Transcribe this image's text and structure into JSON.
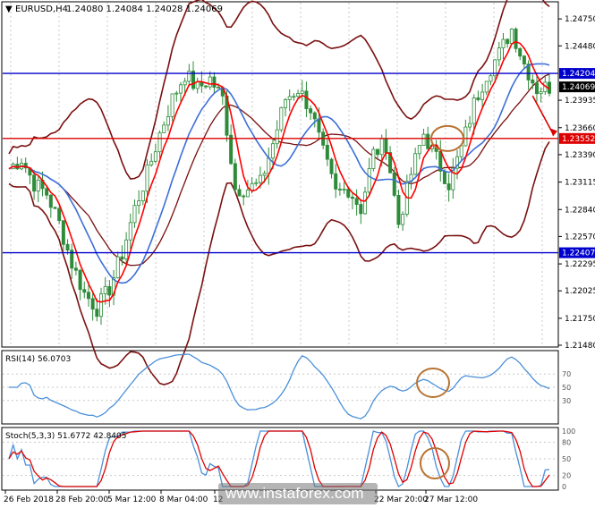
{
  "header": {
    "symbol": "EURUSD,H4",
    "ohlc": "1.24080 1.24084 1.24028 1.24069"
  },
  "colors": {
    "candle": "#2e8b3a",
    "bb_outer": "#7a1010",
    "ma_fast": "#ff0000",
    "ma_slow": "#3c6fd8",
    "level_blue": "#0000cc",
    "level_red": "#dd0000",
    "osc_blue": "#4a90d9",
    "osc_red": "#e00000",
    "annotation": "#b87333"
  },
  "price_axis": {
    "ticks": [
      "1.24750",
      "1.24480",
      "1.23935",
      "1.23660",
      "1.23390",
      "1.23115",
      "1.22840",
      "1.22570",
      "1.22295",
      "1.22025",
      "1.21750",
      "1.21480"
    ],
    "labels": {
      "level_top": "1.24204",
      "current": "1.24069",
      "level_red": "1.23552",
      "level_bottom": "1.22407"
    }
  },
  "rsi": {
    "label": "RSI(14) 56.0703",
    "ticks": [
      "70",
      "50",
      "30"
    ]
  },
  "stoch": {
    "label": "Stoch(5,3,3) 51.6772 42.8405",
    "ticks": [
      "100",
      "80",
      "50",
      "20",
      "0"
    ]
  },
  "time_axis": [
    "26 Feb 2018",
    "28 Feb 20:00",
    "5 Mar 12:00",
    "8 Mar 04:00",
    "12",
    "22 Mar 20:00",
    "27 Mar 12:00"
  ],
  "watermark": "www.instaforex.com",
  "chart_data": {
    "type": "line",
    "title": "EURUSD,H4",
    "price_range": [
      1.2148,
      1.2485
    ],
    "levels": [
      {
        "name": "resistance",
        "value": 1.24204
      },
      {
        "name": "support",
        "value": 1.23552
      },
      {
        "name": "support",
        "value": 1.22407
      }
    ],
    "last_price": 1.24069,
    "close_path": [
      1.2325,
      1.2335,
      1.231,
      1.23,
      1.227,
      1.223,
      1.22,
      1.2185,
      1.2205,
      1.224,
      1.2285,
      1.232,
      1.236,
      1.2395,
      1.242,
      1.2405,
      1.2415,
      1.2395,
      1.2305,
      1.2305,
      1.231,
      1.235,
      1.2395,
      1.2405,
      1.2385,
      1.234,
      1.23,
      1.2305,
      1.2285,
      1.234,
      1.235,
      1.227,
      1.232,
      1.236,
      1.2335,
      1.231,
      1.2345,
      1.239,
      1.242,
      1.244,
      1.2465,
      1.243,
      1.2405,
      1.2407
    ],
    "rsi_value": 56.0703,
    "stoch_main": 51.6772,
    "stoch_signal": 42.8405
  }
}
